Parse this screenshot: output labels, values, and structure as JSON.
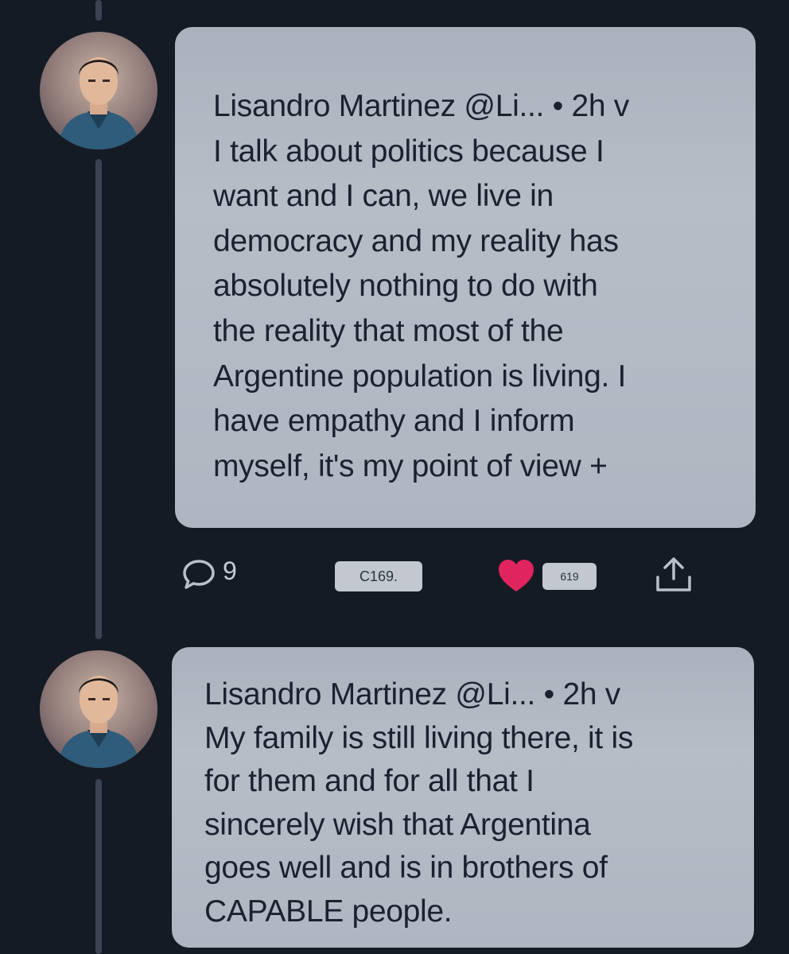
{
  "thread": {
    "tweets": [
      {
        "author": "Lisandro Martinez",
        "handle": "@Li...",
        "time": "2h",
        "menu": "v",
        "lines": [
          "Lisandro Martinez @Li... • 2h v",
          "I talk about politics because I",
          "want and I can, we live in",
          "democracy and my reality has",
          "absolutely nothing to do with",
          "the reality that most of the",
          "Argentine population is living. I",
          "have empathy and I inform",
          "myself, it's my point of view +"
        ],
        "actions": {
          "reply_count": "9",
          "retweet_label": "C169.",
          "like_count": "619"
        }
      },
      {
        "author": "Lisandro Martinez",
        "handle": "@Li...",
        "time": "2h",
        "menu": "v",
        "lines": [
          "Lisandro Martinez @Li... • 2h v",
          "My family is still living there, it is",
          "for them and for all that I",
          "sincerely wish that Argentina",
          "goes well and is in brothers of",
          "CAPABLE people."
        ]
      }
    ]
  },
  "icons": {
    "reply": "speech-bubble-icon",
    "like": "heart-icon",
    "share": "share-icon"
  },
  "colors": {
    "background": "#151b25",
    "bubble": "#b1b9c4",
    "heart": "#e0245e",
    "thread_line": "#3a4352",
    "icon": "#b9c0c9"
  }
}
